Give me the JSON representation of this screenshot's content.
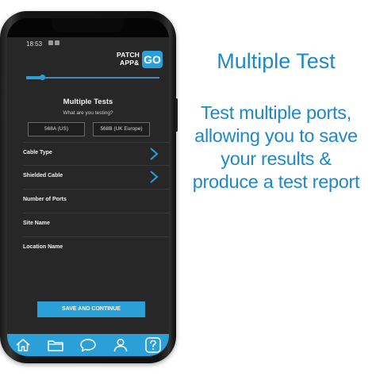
{
  "status": {
    "time": "18:53"
  },
  "logo": {
    "line1": "PATCH",
    "line2": "APP&",
    "go": "GO"
  },
  "progress": {
    "value": 0.12
  },
  "screen": {
    "title": "Multiple Tests",
    "subtitle": "What are you testing?",
    "standards": [
      "568A (US)",
      "568B (UK Europe)"
    ],
    "fields": [
      {
        "label": "Cable Type",
        "chevron": true
      },
      {
        "label": "Shielded Cable",
        "chevron": true
      },
      {
        "label": "Number of Ports",
        "chevron": false
      },
      {
        "label": "Site Name",
        "chevron": false
      },
      {
        "label": "Location Name",
        "chevron": false
      }
    ],
    "save_label": "SAVE AND CONTINUE"
  },
  "tabbar": {
    "icons": [
      "home-icon",
      "folder-icon",
      "chat-icon",
      "user-icon",
      "help-icon"
    ],
    "color": "#2a9fd8"
  },
  "promo": {
    "headline": "Multiple Test",
    "lines": [
      "Test multiple ports,",
      "allowing you to save",
      "your results &",
      "produce a test report"
    ],
    "color": "#1e88c8"
  }
}
